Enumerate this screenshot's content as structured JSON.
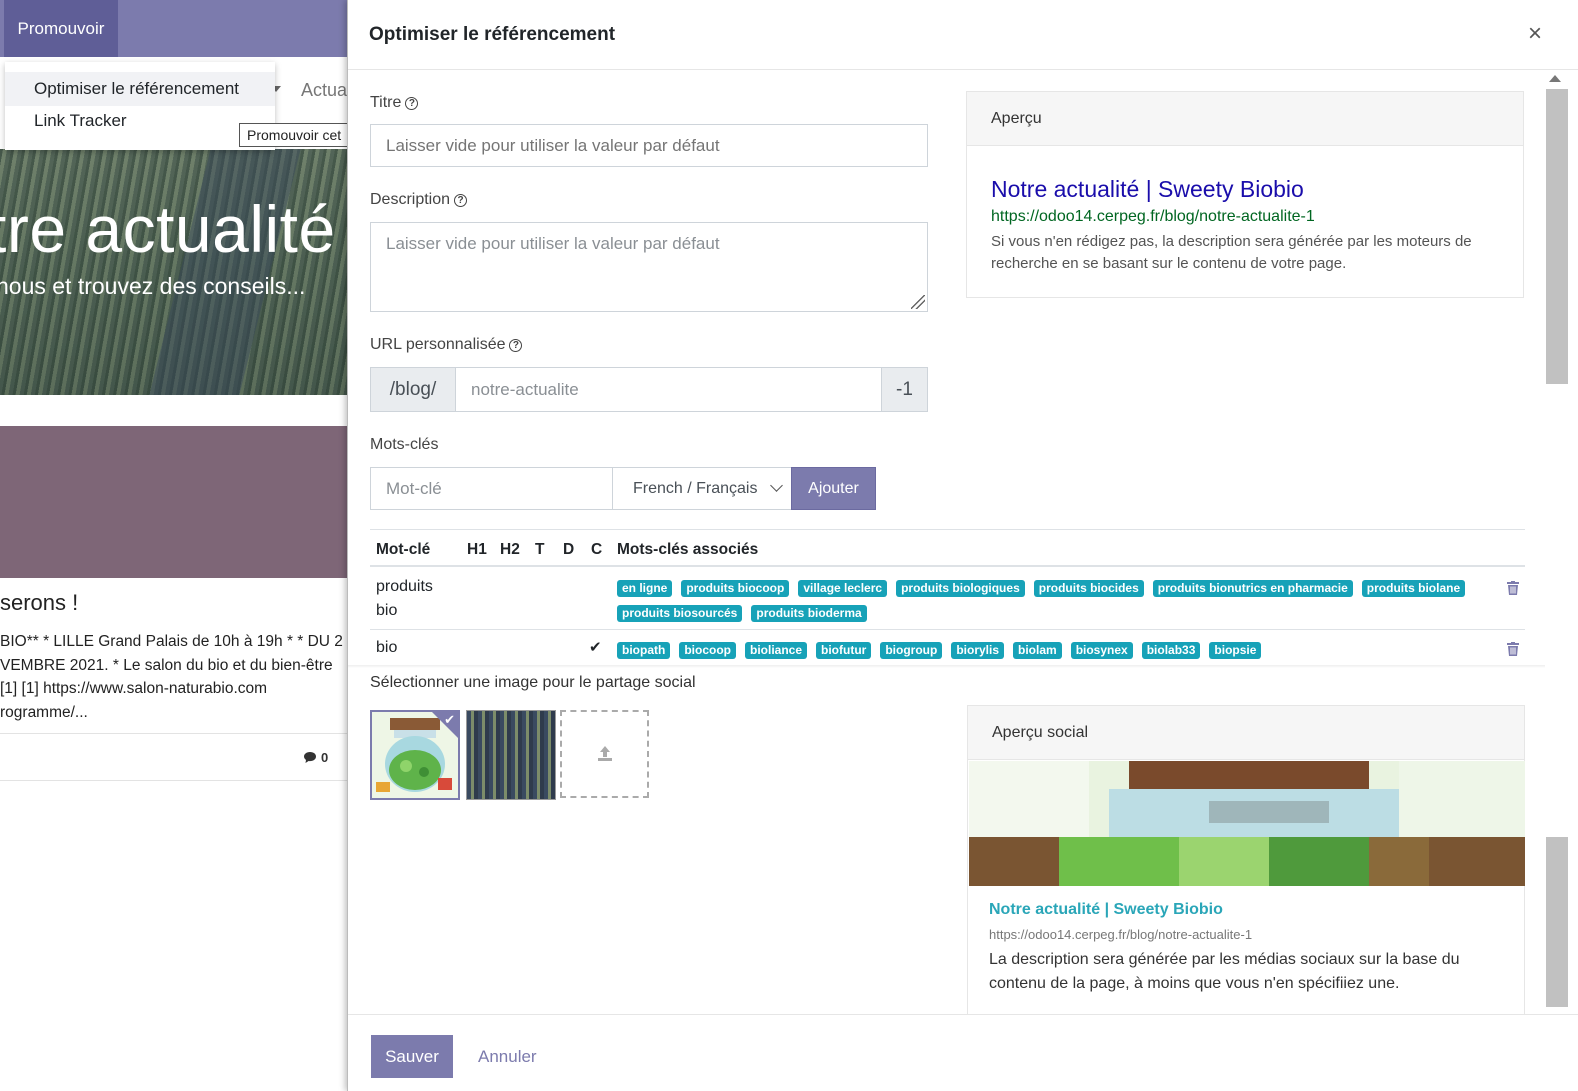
{
  "background_page": {
    "promote_button": "Promouvoir",
    "menu_items": [
      {
        "label": "Optimiser le référencement",
        "active": true
      },
      {
        "label": "Link Tracker",
        "active": false
      }
    ],
    "tooltip": "Promouvoir cet",
    "nav_partial": "Actua",
    "hero_title": "tre actualité",
    "hero_subtitle": "nous et trouvez des conseils...",
    "post_title": "serons !",
    "post_excerpt": "BIO** * LILLE Grand Palais de 10h à 19h * * DU 2\nVEMBRE 2021. * Le salon du bio et du bien-être\n[1] [1] https://www.salon-naturabio.com\nrogramme/...",
    "comment_count": "0"
  },
  "modal": {
    "title": "Optimiser le référencement",
    "close": "×",
    "title_field": {
      "label": "Titre",
      "placeholder": "Laisser vide pour utiliser la valeur par défaut",
      "value": ""
    },
    "description_field": {
      "label": "Description",
      "placeholder": "Laisser vide pour utiliser la valeur par défaut",
      "value": ""
    },
    "url_field": {
      "label": "URL personnalisée",
      "prefix": "/blog/",
      "value": "notre-actualite",
      "suffix": "-1"
    },
    "keywords": {
      "label": "Mots-clés",
      "input_placeholder": "Mot-clé",
      "language": "French / Français",
      "add_button": "Ajouter",
      "headers": [
        "Mot-clé",
        "H1",
        "H2",
        "T",
        "D",
        "C",
        "Mots-clés associés"
      ],
      "rows": [
        {
          "keyword": "produits bio",
          "c": "",
          "related": [
            "en ligne",
            "produits biocoop",
            "village leclerc",
            "produits biologiques",
            "produits biocides",
            "produits bionutrics en pharmacie",
            "produits biolane",
            "produits biosourcés",
            "produits bioderma"
          ]
        },
        {
          "keyword": "bio",
          "c": "✔",
          "related": [
            "biopath",
            "biocoop",
            "bioliance",
            "biofutur",
            "biogroup",
            "biorylis",
            "biolam",
            "biosynex",
            "biolab33",
            "biopsie"
          ]
        }
      ]
    },
    "preview": {
      "header": "Aperçu",
      "title": "Notre actualité | Sweety Biobio",
      "url": "https://odoo14.cerpeg.fr/blog/notre-actualite-1",
      "description": "Si vous n'en rédigez pas, la description sera générée par les moteurs de recherche en se basant sur le contenu de votre page."
    },
    "social_image": {
      "label": "Sélectionner une image pour le partage social"
    },
    "social_preview": {
      "header": "Aperçu social",
      "title": "Notre actualité | Sweety Biobio",
      "url": "https://odoo14.cerpeg.fr/blog/notre-actualite-1",
      "description": "La description sera générée par les médias sociaux sur la base du contenu de la page, à moins que vous n'en spécifiiez une."
    },
    "footer": {
      "save": "Sauver",
      "cancel": "Annuler"
    }
  },
  "colors": {
    "primary": "#7c7bad",
    "tag": "#17a2b8",
    "link": "#1a0dab",
    "url": "#006621"
  }
}
